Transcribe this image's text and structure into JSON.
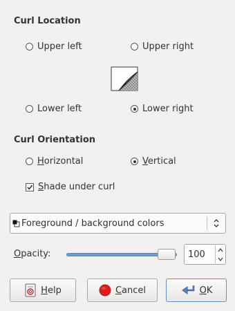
{
  "curl_location": {
    "title": "Curl Location",
    "options": [
      {
        "label": "Upper left",
        "checked": false
      },
      {
        "label": "Upper right",
        "checked": false
      },
      {
        "label": "Lower left",
        "checked": false
      },
      {
        "label": "Lower right",
        "checked": true
      }
    ]
  },
  "curl_orientation": {
    "title": "Curl Orientation",
    "horizontal_mnemonic": "H",
    "horizontal_rest": "orizontal",
    "horizontal_checked": false,
    "vertical_mnemonic": "V",
    "vertical_rest": "ertical",
    "vertical_checked": true
  },
  "shade": {
    "mnemonic": "S",
    "rest": "hade under curl",
    "checked": true
  },
  "gradient_combo": {
    "value": "Foreground / background colors"
  },
  "opacity": {
    "mnemonic": "O",
    "rest": "pacity:",
    "value": "100",
    "fraction": 1.0
  },
  "buttons": {
    "help_mnemonic": "H",
    "help_rest": "elp",
    "cancel_mnemonic": "C",
    "cancel_rest": "ancel",
    "ok_mnemonic": "O",
    "ok_rest": "K"
  },
  "colors": {
    "accent": "#89aed8",
    "cancel_icon": "#e01b1b"
  }
}
